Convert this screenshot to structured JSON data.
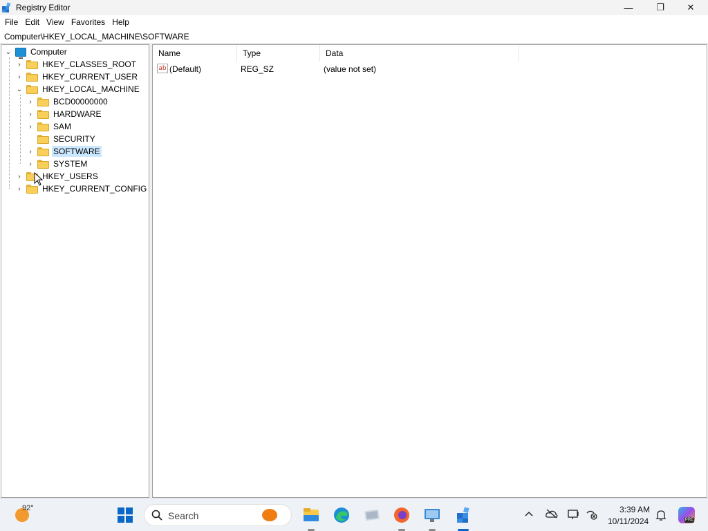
{
  "window": {
    "title": "Registry Editor",
    "minimize_glyph": "—",
    "maximize_glyph": "❐",
    "close_glyph": "✕"
  },
  "menu": {
    "items": [
      "File",
      "Edit",
      "View",
      "Favorites",
      "Help"
    ]
  },
  "address": {
    "path": "Computer\\HKEY_LOCAL_MACHINE\\SOFTWARE"
  },
  "tree": {
    "root": "Computer",
    "hives": [
      "HKEY_CLASSES_ROOT",
      "HKEY_CURRENT_USER",
      "HKEY_LOCAL_MACHINE",
      "HKEY_USERS",
      "HKEY_CURRENT_CONFIG"
    ],
    "hklm_children": [
      "BCD00000000",
      "HARDWARE",
      "SAM",
      "SECURITY",
      "SOFTWARE",
      "SYSTEM"
    ],
    "selected": "SOFTWARE"
  },
  "list": {
    "columns": [
      "Name",
      "Type",
      "Data"
    ],
    "rows": [
      {
        "name": "(Default)",
        "type": "REG_SZ",
        "data": "(value not set)",
        "icon": "ab-string-icon"
      }
    ]
  },
  "taskbar": {
    "weather_temp": "92°",
    "search_placeholder": "Search",
    "time": "3:39 AM",
    "date": "10/11/2024",
    "copilot_badge": "PRE",
    "apps": [
      "file-explorer-icon",
      "edge-icon",
      "app-icon",
      "firefox-icon",
      "remote-desktop-icon",
      "registry-editor-icon"
    ],
    "tray": [
      "chevron-up-icon",
      "onedrive-icon",
      "display-icon",
      "network-icon",
      "notification-icon"
    ]
  },
  "colors": {
    "accent": "#0a67c8",
    "selection": "#cce8ff",
    "folder": "#f8cf58"
  }
}
